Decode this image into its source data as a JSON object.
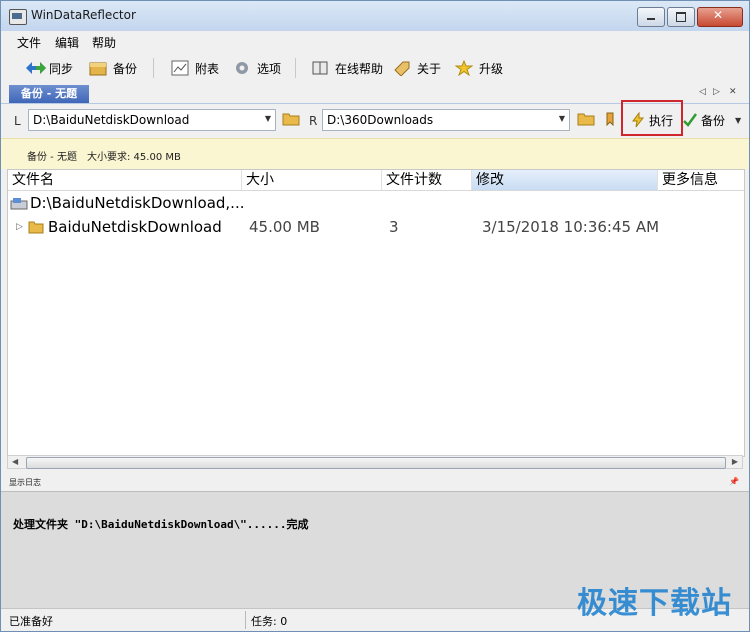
{
  "window": {
    "title": "WinDataReflector"
  },
  "menu": [
    "文件",
    "编辑",
    "帮助"
  ],
  "toolbar": {
    "sync": "同步",
    "backup": "备份",
    "schedule": "附表",
    "options": "选项",
    "online_help": "在线帮助",
    "about": "关于",
    "upgrade": "升级"
  },
  "tab": {
    "label": "备份 - 无题"
  },
  "paths": {
    "left_label": "L",
    "left_path": "D:\\BaiduNetdiskDownload",
    "right_label": "R",
    "right_path": "D:\\360Downloads",
    "execute": "执行",
    "backup": "备份"
  },
  "info": {
    "title": "备份 - 无题",
    "size_label": "大小要求: 45.00 MB"
  },
  "table": {
    "columns": [
      "文件名",
      "大小",
      "文件计数",
      "修改",
      "更多信息"
    ],
    "group": "D:\\BaiduNetdiskDownload,...",
    "rows": [
      {
        "name": "BaiduNetdiskDownload",
        "size": "45.00 MB",
        "count": "3",
        "modified": "3/15/2018 10:36:45 AM"
      }
    ]
  },
  "log": {
    "label": "显示日志",
    "line": "处理文件夹 \"D:\\BaiduNetdiskDownload\\\"......完成"
  },
  "status": {
    "left": "已准备好",
    "tasks": "任务: 0"
  },
  "watermark": "极速下载站",
  "colors": {
    "accent": "#3f66b8",
    "highlight": "#d0262e",
    "info_bg": "#fbf6d2"
  }
}
